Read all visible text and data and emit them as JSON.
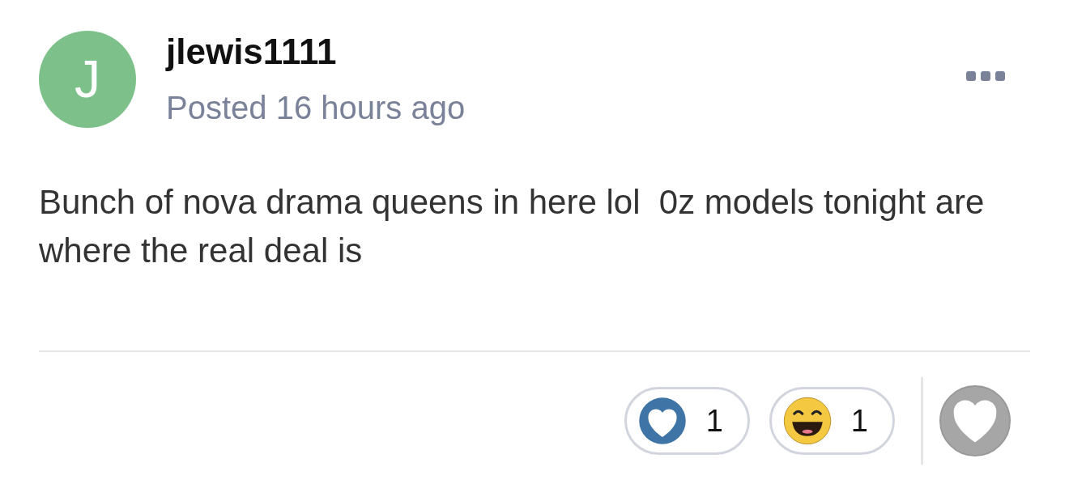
{
  "post": {
    "avatar_letter": "J",
    "username": "jlewis1111",
    "posted": "Posted 16 hours ago",
    "body": "Bunch of nova drama queens in here lol  0z models tonight are where the real deal is"
  },
  "reactions": [
    {
      "kind": "heart",
      "count": "1"
    },
    {
      "kind": "laugh",
      "count": "1"
    }
  ]
}
